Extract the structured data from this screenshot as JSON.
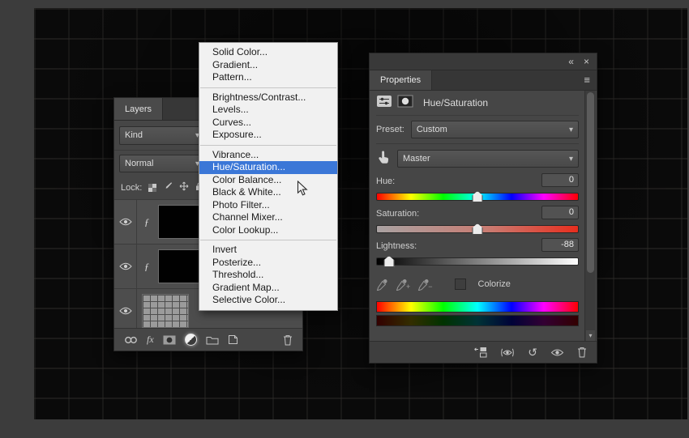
{
  "colors": {
    "menu-highlight": "#3b77d7",
    "panel-bg": "#464646",
    "menu-bg": "#f1f1f1"
  },
  "glyphs": {
    "chevron_down": "▾",
    "collapse_panel": "«",
    "close": "×",
    "panel_menu": "≡",
    "reset": "↺",
    "clip_indicator": "ƒ",
    "fx": "fx",
    "scroll_arrow": "▾",
    "plus": "+",
    "minus": "−"
  },
  "layers_panel": {
    "tab_label": "Layers",
    "filter_kind_value": "Kind",
    "blend_mode_value": "Normal",
    "lock_label": "Lock:"
  },
  "context_menu": {
    "highlighted_item": "Hue/Saturation...",
    "groups": [
      {
        "items": [
          "Solid Color...",
          "Gradient...",
          "Pattern..."
        ]
      },
      {
        "items": [
          "Brightness/Contrast...",
          "Levels...",
          "Curves...",
          "Exposure..."
        ]
      },
      {
        "items": [
          "Vibrance...",
          "Hue/Saturation...",
          "Color Balance...",
          "Black & White...",
          "Photo Filter...",
          "Channel Mixer...",
          "Color Lookup..."
        ]
      },
      {
        "items": [
          "Invert",
          "Posterize...",
          "Threshold...",
          "Gradient Map...",
          "Selective Color..."
        ]
      }
    ]
  },
  "properties_panel": {
    "tab_label": "Properties",
    "adjustment_title": "Hue/Saturation",
    "preset_label": "Preset:",
    "preset_value": "Custom",
    "channel_value": "Master",
    "hue_label": "Hue:",
    "hue_value": "0",
    "saturation_label": "Saturation:",
    "saturation_value": "0",
    "lightness_label": "Lightness:",
    "lightness_value": "-88",
    "colorize_label": "Colorize"
  }
}
